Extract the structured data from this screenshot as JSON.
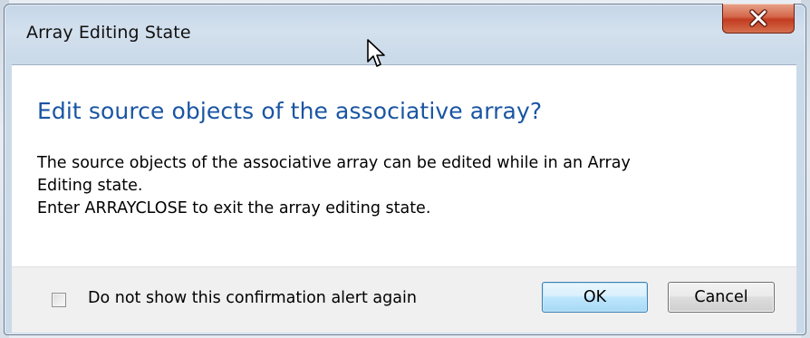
{
  "window": {
    "title": "Array Editing State",
    "close_icon": "close-x-icon"
  },
  "content": {
    "heading": "Edit source objects of the associative array?",
    "message_lines": [
      "The source objects of the associative array can be edited while in an Array",
      "Editing state.",
      "Enter ARRAYCLOSE to exit the array editing state."
    ]
  },
  "footer": {
    "checkbox_label": "Do not show this confirmation alert again",
    "checkbox_checked": false,
    "ok_label": "OK",
    "cancel_label": "Cancel"
  },
  "colors": {
    "heading": "#1a55a3",
    "close_button": "#c23b1f",
    "ok_border": "#3c7fb1"
  },
  "pointer": "mouse-cursor-icon"
}
